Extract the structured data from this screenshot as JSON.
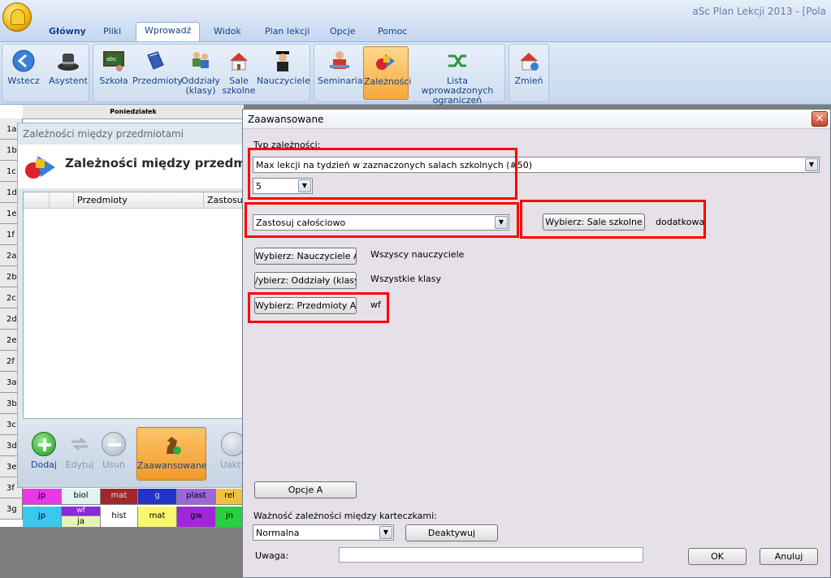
{
  "app": {
    "title": "aSc Plan Lekcji 2013   - [Pola"
  },
  "tabs": [
    {
      "label": "Główny"
    },
    {
      "label": "Pliki"
    },
    {
      "label": "Wprowadź"
    },
    {
      "label": "Widok"
    },
    {
      "label": "Plan lekcji"
    },
    {
      "label": "Opcje"
    },
    {
      "label": "Pomoc"
    }
  ],
  "ribbon": {
    "back": "Wstecz",
    "assistant": "Asystent",
    "subjects_short": "Szkoła",
    "subjects": "Przedmioty",
    "classes_1": "Oddziały",
    "classes_2": "(klasy)",
    "rooms_1": "Sale",
    "rooms_2": "szkolne",
    "teachers": "Nauczyciele",
    "seminars": "Seminaria",
    "constraints": "Zależności",
    "list_1": "Lista wprowadzonych",
    "list_2": "ograniczeń",
    "change": "Zmień"
  },
  "grid": {
    "day_header": "Poniedziałek",
    "rows": [
      "1a",
      "1b",
      "1c",
      "1d",
      "1e",
      "1f",
      "2a",
      "2b",
      "2c",
      "2d",
      "2e",
      "2f",
      "3a",
      "3b",
      "3c",
      "3d",
      "3e",
      "3f",
      "3g"
    ],
    "row_3f": [
      "jp",
      "biol",
      "mat",
      "g",
      "plast",
      "rel"
    ],
    "row_3g_top": [
      "",
      "wf",
      "",
      "",
      "",
      ""
    ],
    "row_3g": [
      "jp",
      "ja",
      "hist",
      "mat",
      "gw",
      "jn"
    ]
  },
  "left_dialog": {
    "title": "Zależności między przedmiotami",
    "header": "Zależności między przedmiotami",
    "col_subjects": "Przedmioty",
    "col_apply": "Zastosuj c",
    "add": "Dodaj",
    "edit": "Edytuj",
    "remove": "Usuń",
    "advanced": "Zaawansowane",
    "activate": "Uakty"
  },
  "dialog": {
    "title": "Zaawansowane",
    "type_label": "Typ zależności:",
    "type_value": "Max lekcji na tydzień w zaznaczonych salach szkolnych (#50)",
    "count_value": "5",
    "apply_value": "Zastosuj całościowo",
    "rooms_button": "Wybierz: Sale szkolne",
    "rooms_value": "dodatkowa",
    "teachers_button": "Wybierz: Nauczyciele A",
    "teachers_value": "Wszyscy nauczyciele",
    "classes_button": "/ybierz: Oddziały (klasy) A",
    "classes_value": "Wszystkie klasy",
    "subjects_button": "Wybierz: Przedmioty A",
    "subjects_value": "wf",
    "options_button": "Opcje A",
    "importance_label": "Ważność zależności między karteczkami:",
    "importance_value": "Normalna",
    "deactivate_button": "Deaktywuj",
    "note_label": "Uwaga:",
    "note_value": "",
    "ok_button": "OK",
    "cancel_button": "Anuluj"
  },
  "colors": {
    "highlight": "#ff0000",
    "ribbon_text": "#15428b",
    "active_button": "#f6a83c"
  }
}
